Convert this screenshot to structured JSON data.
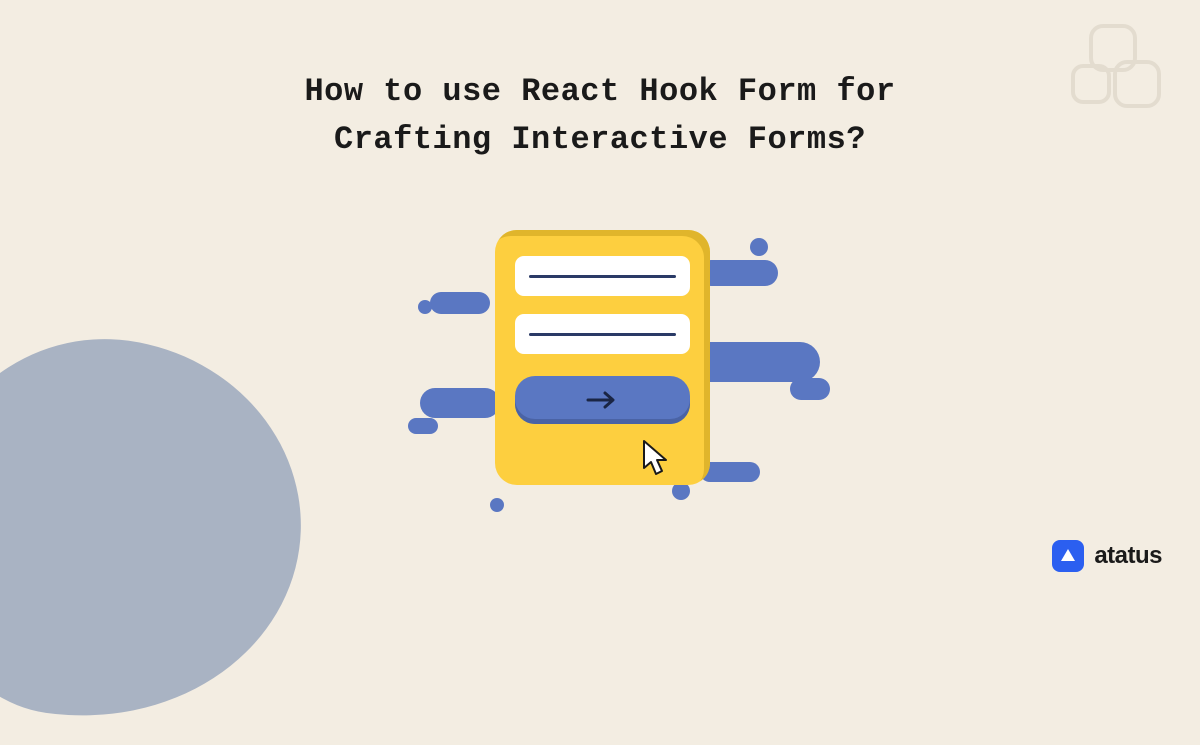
{
  "title_line1": "How to use React Hook Form for",
  "title_line2": "Crafting Interactive Forms?",
  "brand": {
    "name": "atatus"
  },
  "colors": {
    "background": "#f3ede2",
    "accent_yellow": "#fdcf3f",
    "accent_blue": "#5a77c2",
    "blob_gray": "#a9b3c3",
    "brand_blue": "#2b5ff0"
  }
}
